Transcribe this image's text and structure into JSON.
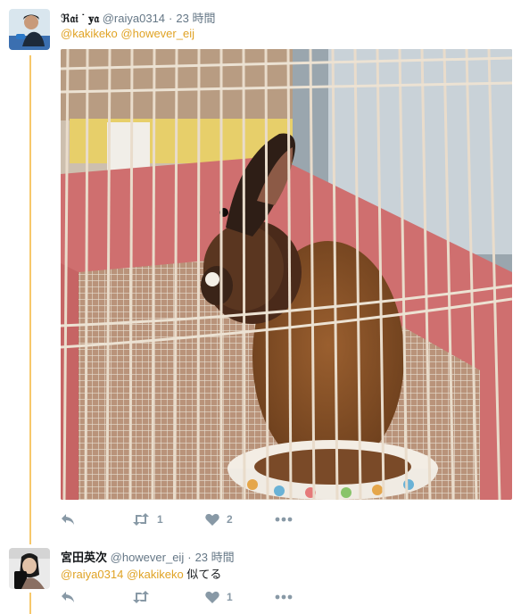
{
  "tweets": [
    {
      "display_name": "ℜ𝔞𝔦 ˙ 𝐲𝔞",
      "handle": "@raiya0314",
      "time": "23 時間",
      "mentions": [
        "@kakikeko",
        "@however_eij"
      ],
      "text": "",
      "actions": {
        "reply_count": "",
        "retweet_count": "1",
        "like_count": "2"
      }
    },
    {
      "display_name": "宮田英次",
      "handle": "@however_eij",
      "time": "23 時間",
      "mentions": [
        "@raiya0314",
        "@kakikeko"
      ],
      "text": "似てる",
      "actions": {
        "reply_count": "",
        "retweet_count": "",
        "like_count": "1"
      }
    }
  ],
  "separator": "·",
  "icons": {
    "reply": "reply-icon",
    "retweet": "retweet-icon",
    "like": "heart-icon",
    "more": "more-icon"
  },
  "colors": {
    "mention": "#e0a325",
    "thread_line": "#f7c86b",
    "icon": "#8899a6",
    "meta": "#657786"
  }
}
